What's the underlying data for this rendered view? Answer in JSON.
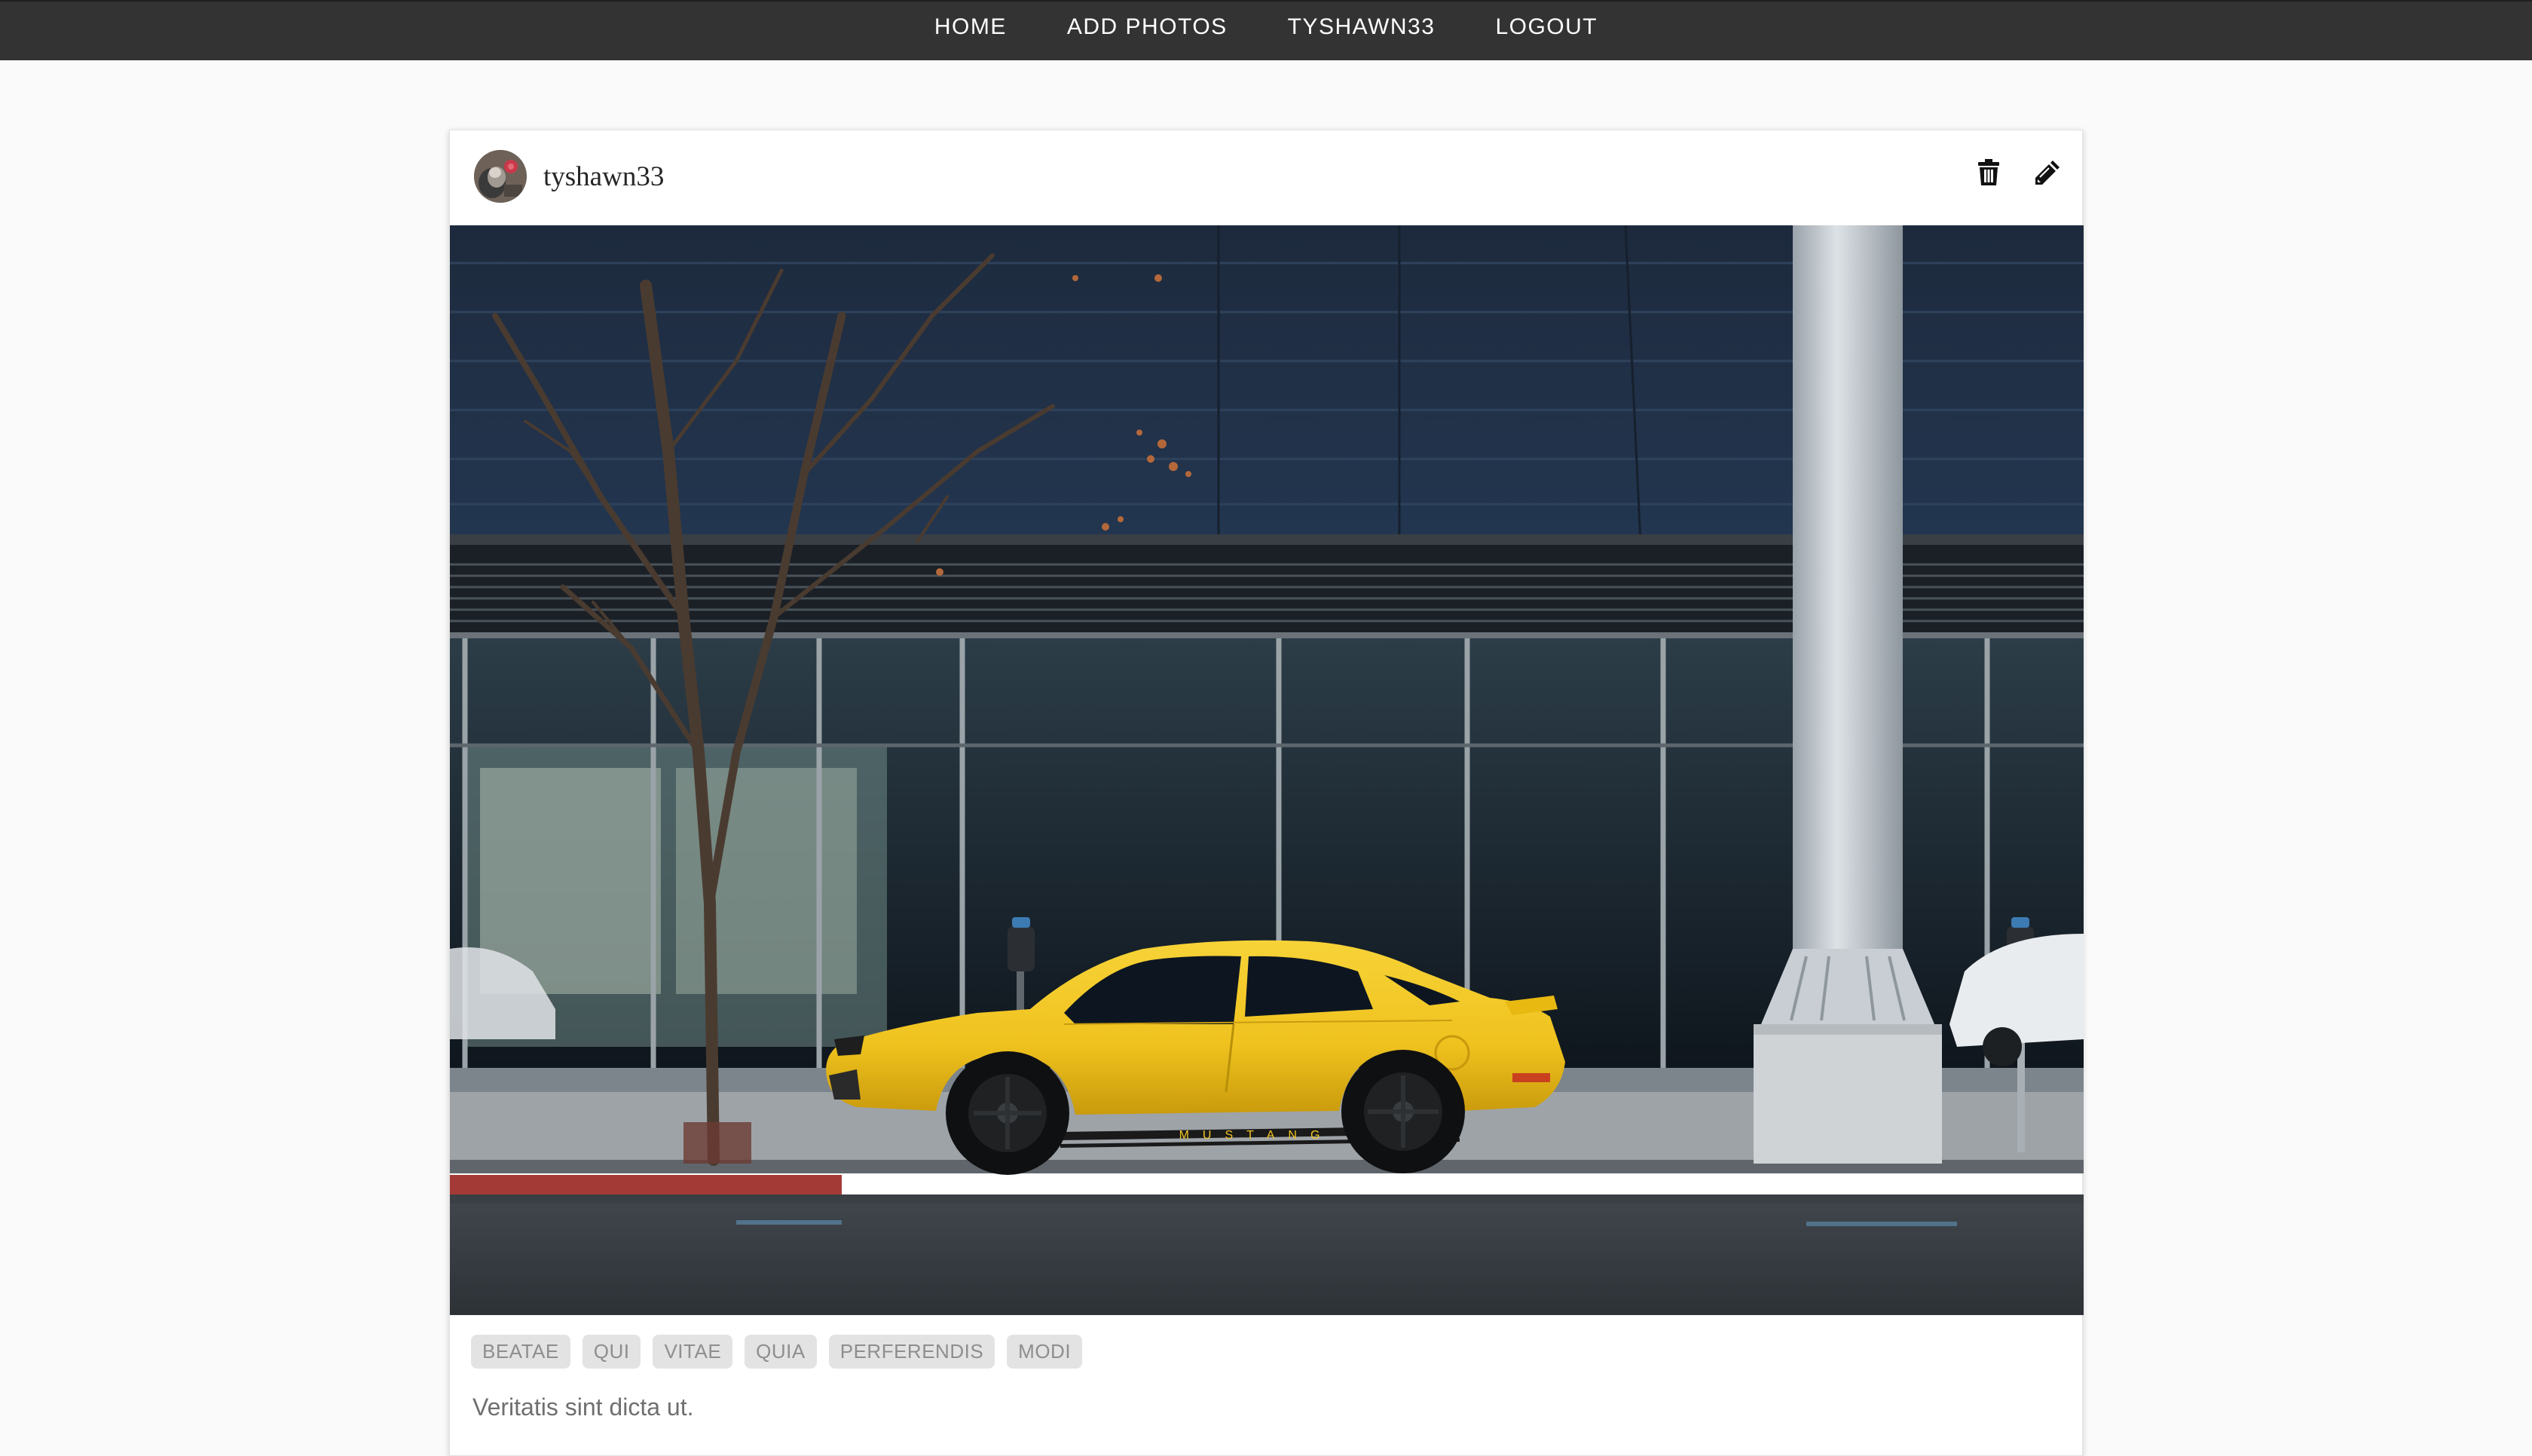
{
  "nav": {
    "items": [
      {
        "label": "HOME"
      },
      {
        "label": "ADD PHOTOS"
      },
      {
        "label": "TYSHAWN33"
      },
      {
        "label": "LOGOUT"
      }
    ]
  },
  "post": {
    "username": "tyshawn33",
    "avatar_icon": "user-avatar",
    "actions": {
      "delete_icon": "trash-icon",
      "edit_icon": "pencil-icon"
    },
    "photo_brand_text": "MUSTANG",
    "tags": [
      "BEATAE",
      "QUI",
      "VITAE",
      "QUIA",
      "PERFERENDIS",
      "MODI"
    ],
    "caption": "Veritatis sint dicta ut."
  },
  "colors": {
    "navbar": "#333333",
    "page_background": "#fafafa",
    "tag_background": "#e3e3e3",
    "tag_text": "#8e8e8e",
    "car_yellow": "#f2c525"
  }
}
